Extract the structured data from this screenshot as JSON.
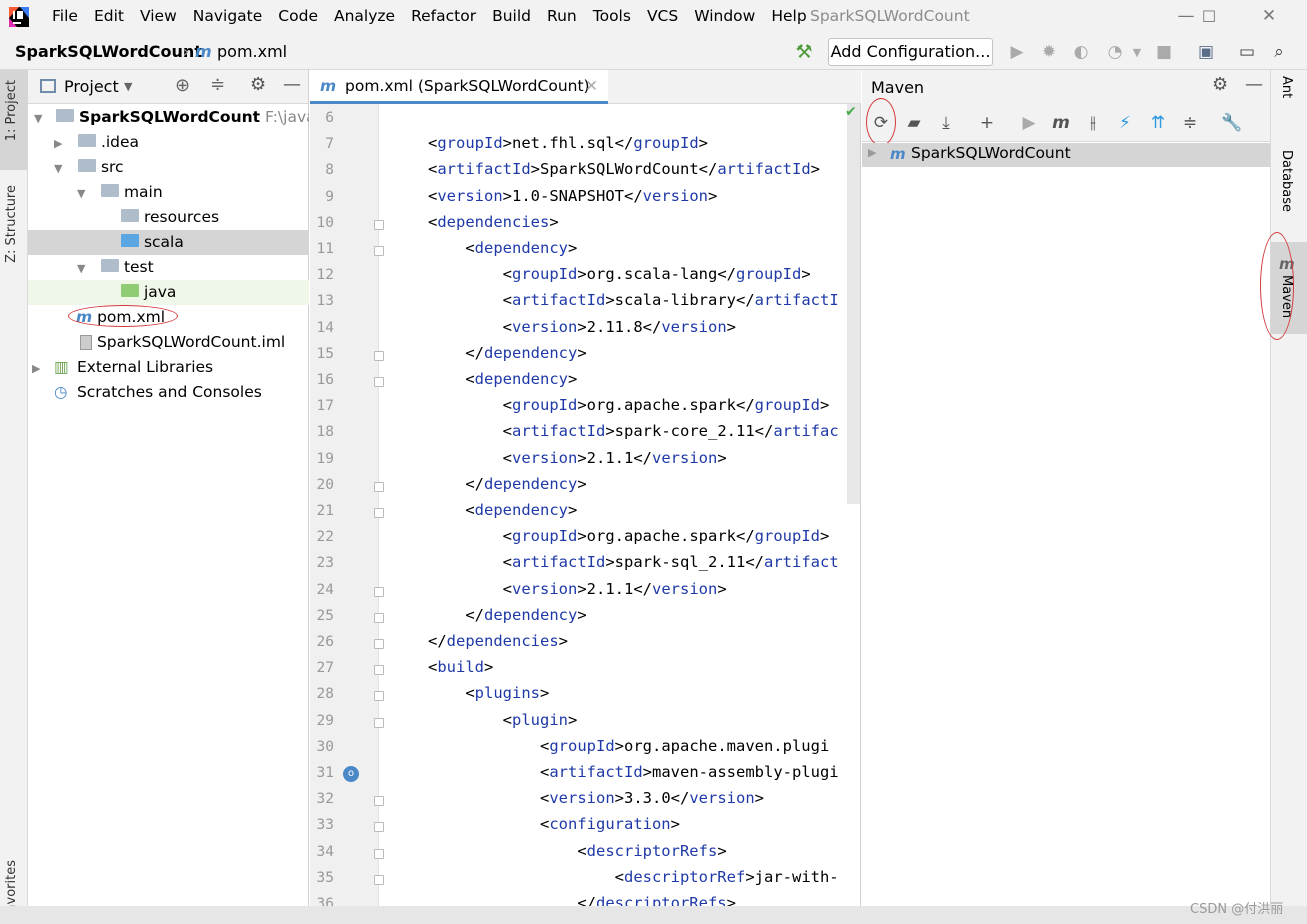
{
  "menu": [
    "File",
    "Edit",
    "View",
    "Navigate",
    "Code",
    "Analyze",
    "Refactor",
    "Build",
    "Run",
    "Tools",
    "VCS",
    "Window",
    "Help"
  ],
  "window_title": "SparkSQLWordCount",
  "breadcrumb": {
    "project": "SparkSQLWordCount",
    "file": "pom.xml"
  },
  "toolbar": {
    "add_configuration": "Add Configuration..."
  },
  "left_tabs": {
    "project": "1: Project",
    "structure": "Z: Structure",
    "favorites": "avorites"
  },
  "project_panel": {
    "title": "Project",
    "tree": [
      {
        "label": "SparkSQLWordCount",
        "extra": "F:\\java\\Sp",
        "bold": true
      },
      {
        "label": ".idea"
      },
      {
        "label": "src"
      },
      {
        "label": "main"
      },
      {
        "label": "resources"
      },
      {
        "label": "scala"
      },
      {
        "label": "test"
      },
      {
        "label": "java"
      },
      {
        "label": "pom.xml"
      },
      {
        "label": "SparkSQLWordCount.iml"
      },
      {
        "label": "External Libraries"
      },
      {
        "label": "Scratches and Consoles"
      }
    ]
  },
  "editor": {
    "tab_label": "pom.xml (SparkSQLWordCount)",
    "first_line": 6,
    "lines": [
      "",
      "<groupId>net.fhl.sql</groupId>",
      "<artifactId>SparkSQLWordCount</artifactId>",
      "<version>1.0-SNAPSHOT</version>",
      "<dependencies>",
      "    <dependency>",
      "        <groupId>org.scala-lang</groupId>",
      "        <artifactId>scala-library</artifactI",
      "        <version>2.11.8</version>",
      "    </dependency>",
      "    <dependency>",
      "        <groupId>org.apache.spark</groupId>",
      "        <artifactId>spark-core_2.11</artifac",
      "        <version>2.1.1</version>",
      "    </dependency>",
      "    <dependency>",
      "        <groupId>org.apache.spark</groupId>",
      "        <artifactId>spark-sql_2.11</artifact",
      "        <version>2.1.1</version>",
      "    </dependency>",
      "</dependencies>",
      "<build>",
      "    <plugins>",
      "        <plugin>",
      "            <groupId>org.apache.maven.plugi",
      "            <artifactId>maven-assembly-plugi",
      "            <version>3.3.0</version>",
      "            <configuration>",
      "                <descriptorRefs>",
      "                    <descriptorRef>jar-with-",
      "                </descriptorRefs>"
    ]
  },
  "maven": {
    "title": "Maven",
    "project": "SparkSQLWordCount"
  },
  "right_tabs": {
    "ant": "Ant",
    "database": "Database",
    "maven": "Maven"
  },
  "watermark": "CSDN @付洪丽",
  "colors": {
    "accent": "#4a88c7",
    "tag": "#1f3aa8",
    "annotation": "#d43b3b"
  }
}
